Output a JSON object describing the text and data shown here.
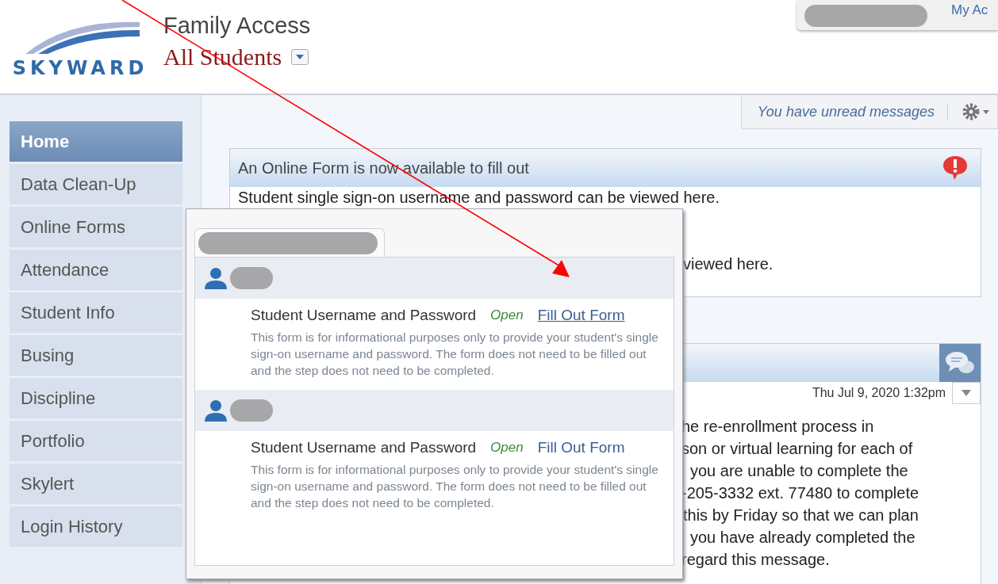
{
  "header": {
    "logo": "SKYWARD",
    "app_title": "Family Access",
    "student_selector": "All Students",
    "account_link": "My Ac"
  },
  "sidebar": {
    "items": [
      {
        "label": "Home",
        "selected": true
      },
      {
        "label": "Data Clean-Up",
        "selected": false
      },
      {
        "label": "Online Forms",
        "selected": false
      },
      {
        "label": "Attendance",
        "selected": false
      },
      {
        "label": "Student Info",
        "selected": false
      },
      {
        "label": "Busing",
        "selected": false
      },
      {
        "label": "Discipline",
        "selected": false
      },
      {
        "label": "Portfolio",
        "selected": false
      },
      {
        "label": "Skylert",
        "selected": false
      },
      {
        "label": "Login History",
        "selected": false
      }
    ]
  },
  "toolbar": {
    "messages_notice": "You have unread messages"
  },
  "form_panel": {
    "title": "An Online Form is now available to fill out",
    "lines": [
      "Student single sign-on username and password can be viewed here.",
      "viewed here."
    ]
  },
  "message_panel": {
    "date": "Thu Jul 9, 2020 1:32pm",
    "lines": [
      "he re-enrollment process in",
      "son or virtual learning for each of",
      "you are unable to complete the",
      "-205-3332 ext. 77480 to complete",
      "this by Friday so that we can plan",
      "you have already completed the",
      "regard this message."
    ]
  },
  "popup": {
    "students": [
      {
        "forms": [
          {
            "name": "Student Username and Password",
            "status": "Open",
            "action": "Fill Out Form",
            "hovered": true,
            "description": "This form is for informational purposes only to provide your student's single sign-on username and password. The form does not need to be filled out and the step does not need to be completed."
          }
        ]
      },
      {
        "forms": [
          {
            "name": "Student Username and Password",
            "status": "Open",
            "action": "Fill Out Form",
            "hovered": false,
            "description": "This form is for informational purposes only to provide your student's single sign-on username and password. The form does not need to be filled out and the step does not need to be completed."
          }
        ]
      }
    ]
  }
}
